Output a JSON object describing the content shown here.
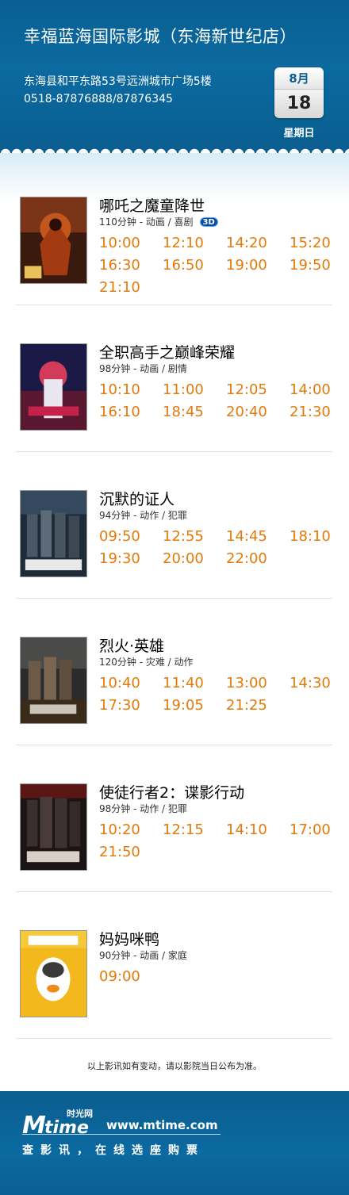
{
  "cinema": {
    "title": "幸福蓝海国际影城（东海新世纪店）",
    "address": "东海县和平东路53号远洲城市广场5楼",
    "phone": "0518-87876888/87876345"
  },
  "date": {
    "month": "8月",
    "day": "18",
    "weekday": "星期日"
  },
  "colors": {
    "header_bg": "#0b6aa0",
    "showtime": "#e37a0b",
    "badge_3d": "#0a4aa6"
  },
  "movies": [
    {
      "name": "哪吒之魔童降世",
      "info": "110分钟 - 动画 / 喜剧",
      "badge": "3D",
      "times": [
        "10:00",
        "12:10",
        "14:20",
        "15:20",
        "16:30",
        "16:50",
        "19:00",
        "19:50",
        "21:10"
      ]
    },
    {
      "name": "全职高手之巅峰荣耀",
      "info": "98分钟 - 动画 / 剧情",
      "times": [
        "10:10",
        "11:00",
        "12:05",
        "14:00",
        "16:10",
        "18:45",
        "20:40",
        "21:30"
      ]
    },
    {
      "name": "沉默的证人",
      "info": "94分钟 - 动作 / 犯罪",
      "times": [
        "09:50",
        "12:55",
        "14:45",
        "18:10",
        "19:30",
        "20:00",
        "22:00"
      ]
    },
    {
      "name": "烈火·英雄",
      "info": "120分钟 - 灾难 / 动作",
      "times": [
        "10:40",
        "11:40",
        "13:00",
        "14:30",
        "17:30",
        "19:05",
        "21:25"
      ]
    },
    {
      "name": "使徒行者2：谍影行动",
      "info": "98分钟 - 动作 / 犯罪",
      "times": [
        "10:20",
        "12:15",
        "14:10",
        "17:00",
        "21:50"
      ]
    },
    {
      "name": "妈妈咪鸭",
      "info": "90分钟 - 动画 / 家庭",
      "times": [
        "09:00"
      ]
    }
  ],
  "notice": "以上影讯如有变动，请以影院当日公布为准。",
  "footer": {
    "logo_cn": "时光网",
    "logo_m": "M",
    "logo_time": "time",
    "site": "www.mtime.com",
    "slogan": "查影讯，在线选座购票"
  }
}
